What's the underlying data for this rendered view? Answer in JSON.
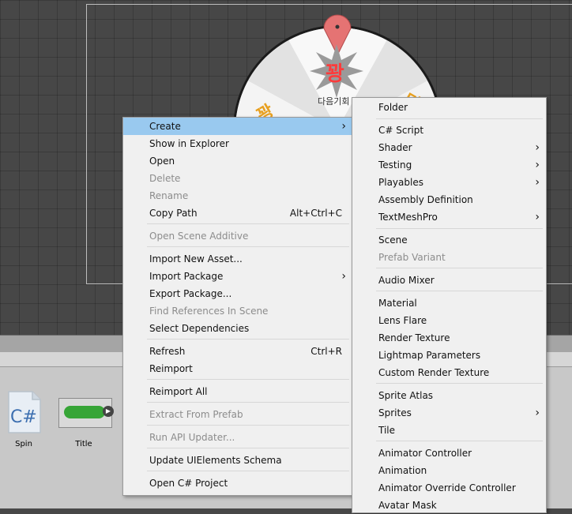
{
  "scene": {
    "center_title": "꽝",
    "center_subtitle": "다음기회",
    "slot_left": "꽝",
    "slot_right": "다"
  },
  "project_assets": [
    {
      "name": "Spin",
      "icon": "csharp-script-icon",
      "icon_text": "C#"
    },
    {
      "name": "Title",
      "icon": "scene-thumbnail-icon",
      "icon_text": ""
    }
  ],
  "context_menu": {
    "items": [
      {
        "label": "Create",
        "shortcut": "",
        "submenu": true,
        "disabled": false,
        "highlight": true
      },
      {
        "label": "Show in Explorer",
        "shortcut": "",
        "submenu": false,
        "disabled": false
      },
      {
        "label": "Open",
        "shortcut": "",
        "submenu": false,
        "disabled": false
      },
      {
        "label": "Delete",
        "shortcut": "",
        "submenu": false,
        "disabled": true
      },
      {
        "label": "Rename",
        "shortcut": "",
        "submenu": false,
        "disabled": true
      },
      {
        "label": "Copy Path",
        "shortcut": "Alt+Ctrl+C",
        "submenu": false,
        "disabled": false
      },
      {
        "label": "Open Scene Additive",
        "shortcut": "",
        "submenu": false,
        "disabled": true
      },
      {
        "label": "Import New Asset...",
        "shortcut": "",
        "submenu": false,
        "disabled": false
      },
      {
        "label": "Import Package",
        "shortcut": "",
        "submenu": true,
        "disabled": false
      },
      {
        "label": "Export Package...",
        "shortcut": "",
        "submenu": false,
        "disabled": false
      },
      {
        "label": "Find References In Scene",
        "shortcut": "",
        "submenu": false,
        "disabled": true
      },
      {
        "label": "Select Dependencies",
        "shortcut": "",
        "submenu": false,
        "disabled": false
      },
      {
        "label": "Refresh",
        "shortcut": "Ctrl+R",
        "submenu": false,
        "disabled": false
      },
      {
        "label": "Reimport",
        "shortcut": "",
        "submenu": false,
        "disabled": false
      },
      {
        "label": "Reimport All",
        "shortcut": "",
        "submenu": false,
        "disabled": false
      },
      {
        "label": "Extract From Prefab",
        "shortcut": "",
        "submenu": false,
        "disabled": true
      },
      {
        "label": "Run API Updater...",
        "shortcut": "",
        "submenu": false,
        "disabled": true
      },
      {
        "label": "Update UIElements Schema",
        "shortcut": "",
        "submenu": false,
        "disabled": false
      },
      {
        "label": "Open C# Project",
        "shortcut": "",
        "submenu": false,
        "disabled": false
      }
    ]
  },
  "create_submenu": {
    "items": [
      {
        "label": "Folder",
        "submenu": false,
        "disabled": false
      },
      {
        "label": "C# Script",
        "submenu": false,
        "disabled": false
      },
      {
        "label": "Shader",
        "submenu": true,
        "disabled": false
      },
      {
        "label": "Testing",
        "submenu": true,
        "disabled": false
      },
      {
        "label": "Playables",
        "submenu": true,
        "disabled": false
      },
      {
        "label": "Assembly Definition",
        "submenu": false,
        "disabled": false
      },
      {
        "label": "TextMeshPro",
        "submenu": true,
        "disabled": false
      },
      {
        "label": "Scene",
        "submenu": false,
        "disabled": false
      },
      {
        "label": "Prefab Variant",
        "submenu": false,
        "disabled": true
      },
      {
        "label": "Audio Mixer",
        "submenu": false,
        "disabled": false
      },
      {
        "label": "Material",
        "submenu": false,
        "disabled": false
      },
      {
        "label": "Lens Flare",
        "submenu": false,
        "disabled": false
      },
      {
        "label": "Render Texture",
        "submenu": false,
        "disabled": false
      },
      {
        "label": "Lightmap Parameters",
        "submenu": false,
        "disabled": false
      },
      {
        "label": "Custom Render Texture",
        "submenu": false,
        "disabled": false
      },
      {
        "label": "Sprite Atlas",
        "submenu": false,
        "disabled": false
      },
      {
        "label": "Sprites",
        "submenu": true,
        "disabled": false
      },
      {
        "label": "Tile",
        "submenu": false,
        "disabled": false
      },
      {
        "label": "Animator Controller",
        "submenu": false,
        "disabled": false
      },
      {
        "label": "Animation",
        "submenu": false,
        "disabled": false
      },
      {
        "label": "Animator Override Controller",
        "submenu": false,
        "disabled": false
      },
      {
        "label": "Avatar Mask",
        "submenu": false,
        "disabled": false
      }
    ]
  },
  "colors": {
    "highlight": "#99c9ef",
    "disabled_text": "#8c8c8c",
    "menu_bg": "#f0f0f0"
  }
}
